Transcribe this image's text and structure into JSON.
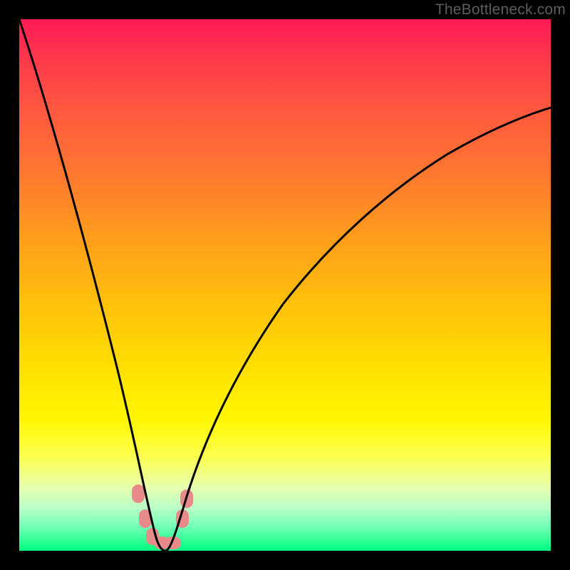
{
  "watermark": "TheBottleneck.com",
  "chart_data": {
    "type": "line",
    "title": "",
    "xlabel": "",
    "ylabel": "",
    "xlim": [
      0,
      100
    ],
    "ylim": [
      0,
      100
    ],
    "grid": false,
    "legend": false,
    "series": [
      {
        "name": "bottleneck-curve",
        "x": [
          0,
          5,
          10,
          15,
          20,
          22,
          24,
          26,
          27,
          28,
          30,
          35,
          40,
          50,
          60,
          70,
          80,
          90,
          100
        ],
        "y": [
          100,
          82,
          63,
          44,
          24,
          15,
          6,
          0,
          0,
          0,
          6,
          20,
          32,
          49,
          60,
          68,
          74,
          79,
          83
        ],
        "color": "#000000"
      }
    ],
    "markers": {
      "name": "highlight-dots",
      "points": [
        {
          "x": 22.2,
          "y": 10.5
        },
        {
          "x": 23.5,
          "y": 6.0
        },
        {
          "x": 24.8,
          "y": 2.2
        },
        {
          "x": 26.3,
          "y": 0.7
        },
        {
          "x": 28.0,
          "y": 0.7
        },
        {
          "x": 30.6,
          "y": 6.0
        },
        {
          "x": 31.3,
          "y": 9.5
        }
      ],
      "color": "#e88a8a",
      "size": 16
    },
    "background_gradient": {
      "top": "#ff1a55",
      "bottom": "#00ff7f"
    }
  }
}
